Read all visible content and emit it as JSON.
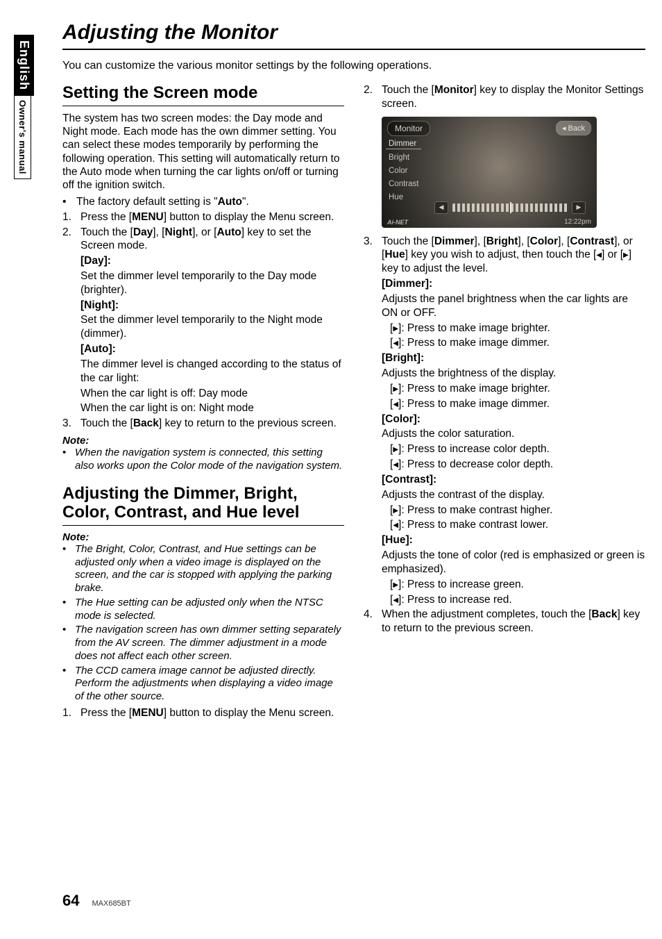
{
  "sideTabs": {
    "lang": "English",
    "doc": "Owner's manual"
  },
  "pageTitle": "Adjusting the Monitor",
  "intro": "You can customize the various monitor settings by the following operations.",
  "leftCol": {
    "h2a": "Setting the Screen mode",
    "p1": "The system has two screen modes: the Day mode and Night mode. Each mode has the own dimmer setting. You can select these modes temporarily by performing the following operation. This setting will automatically return to the Auto mode when turning the car lights on/off or turning off the ignition switch.",
    "b1_pre": "The factory default setting is \"",
    "b1_bold": "Auto",
    "b1_post": "\".",
    "s1_num": "1.",
    "s1_a": "Press the [",
    "s1_b": "MENU",
    "s1_c": "] button to display the Menu screen.",
    "s2_num": "2.",
    "s2_a": "Touch the [",
    "s2_b": "Day",
    "s2_c": "], [",
    "s2_d": "Night",
    "s2_e": "], or [",
    "s2_f": "Auto",
    "s2_g": "] key to set the Screen mode.",
    "day_lbl": "[Day]:",
    "day_txt": "Set the dimmer level temporarily to the Day mode (brighter).",
    "night_lbl": "[Night]:",
    "night_txt": "Set the dimmer level temporarily to the Night mode (dimmer).",
    "auto_lbl": "[Auto]:",
    "auto_txt1": "The dimmer level is changed according to the status of the car light:",
    "auto_txt2": "When the car light is off: Day mode",
    "auto_txt3": "When the car light is on: Night mode",
    "s3_num": "3.",
    "s3_a": "Touch the [",
    "s3_b": "Back",
    "s3_c": "] key to return to the previous screen.",
    "noteHead1": "Note:",
    "note1": "When the navigation system is connected, this setting also works upon the Color mode of the navigation system.",
    "h2b": "Adjusting the Dimmer, Bright, Color, Contrast, and Hue level",
    "noteHead2": "Note:",
    "noteB1": "The Bright, Color, Contrast, and Hue settings can be adjusted only when a video image is displayed on the screen, and the car is stopped with applying the parking brake.",
    "noteB2": "The Hue setting can be adjusted only when the NTSC mode is selected.",
    "noteB3": "The navigation screen has own dimmer setting separately from the AV screen. The dimmer adjustment in a mode does not affect each other screen.",
    "noteB4": "The CCD camera image cannot be adjusted directly. Perform the adjustments when displaying a video image of the other source.",
    "sB1_num": "1.",
    "sB1_a": "Press the [",
    "sB1_b": "MENU",
    "sB1_c": "] button to display the Menu screen."
  },
  "rightCol": {
    "s2_num": "2.",
    "s2_a": "Touch the [",
    "s2_b": "Monitor",
    "s2_c": "] key to display the Monitor Settings screen.",
    "screenshot": {
      "title": "Monitor",
      "back": "◂ Back",
      "menu": [
        "Dimmer",
        "Bright",
        "Color",
        "Contrast",
        "Hue"
      ],
      "time": "12:22pm",
      "logo": "Ai-NET"
    },
    "s3_num": "3.",
    "s3_a": "Touch the [",
    "s3_b": "Dimmer",
    "s3_c": "], [",
    "s3_d": "Bright",
    "s3_e": "], [",
    "s3_f": "Color",
    "s3_g": "], [",
    "s3_h": "Contrast",
    "s3_i": "], or [",
    "s3_j": "Hue",
    "s3_k": "] key you wish to adjust, then touch the [",
    "s3_l": "] or [",
    "s3_m": "] key to adjust the level.",
    "dimmer_lbl": "[Dimmer]:",
    "dimmer_txt": "Adjusts the panel brightness when the car lights are ON or OFF.",
    "dimmer_r": "]: Press to make image brighter.",
    "dimmer_l": "]: Press to make image dimmer.",
    "bright_lbl": "[Bright]:",
    "bright_txt": "Adjusts the brightness of the display.",
    "bright_r": "]: Press to make image brighter.",
    "bright_l": "]: Press to make image dimmer.",
    "color_lbl": "[Color]:",
    "color_txt": "Adjusts the color saturation.",
    "color_r": "]: Press to increase color depth.",
    "color_l": "]: Press to decrease color depth.",
    "contrast_lbl": "[Contrast]:",
    "contrast_txt": "Adjusts the contrast of the display.",
    "contrast_r": "]: Press to make contrast higher.",
    "contrast_l": "]: Press to make contrast lower.",
    "hue_lbl": "[Hue]:",
    "hue_txt": "Adjusts the tone of color (red is emphasized or green is emphasized).",
    "hue_r": "]: Press to increase green.",
    "hue_l": "]: Press to increase red.",
    "s4_num": "4.",
    "s4_a": "When the adjustment completes, touch the [",
    "s4_b": "Back",
    "s4_c": "] key to return to the previous screen."
  },
  "footer": {
    "pageNum": "64",
    "model": "MAX685BT"
  }
}
